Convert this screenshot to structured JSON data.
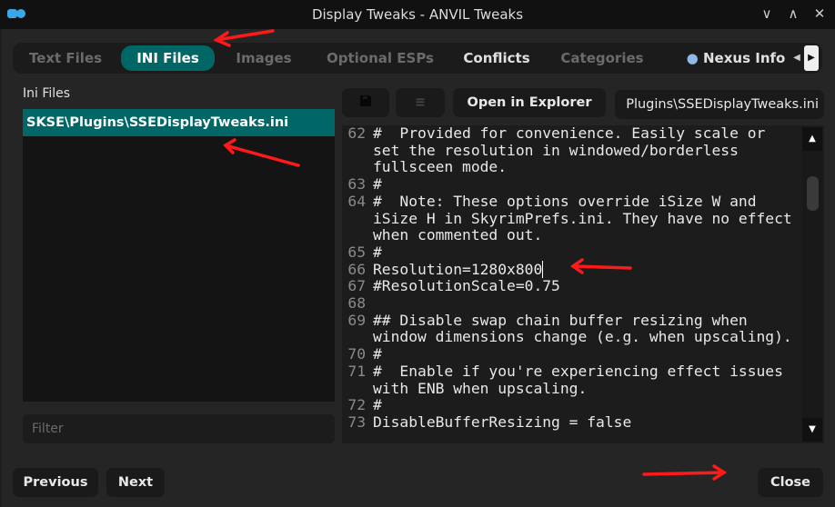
{
  "window": {
    "title": "Display Tweaks - ANVIL Tweaks",
    "minimize": "∨",
    "maximize": "∧",
    "close": "✕"
  },
  "tabs": [
    {
      "label": "Text Files"
    },
    {
      "label": "INI Files",
      "active": true
    },
    {
      "label": "Images"
    },
    {
      "label": "Optional ESPs"
    },
    {
      "label": "Conflicts"
    },
    {
      "label": "Categories"
    },
    {
      "label": "Nexus Info"
    }
  ],
  "sidebar": {
    "title": "Ini Files",
    "items": [
      {
        "label": "SKSE\\Plugins\\SSEDisplayTweaks.ini",
        "selected": true
      }
    ],
    "filter_placeholder": "Filter"
  },
  "toolbar": {
    "save_icon": "save-icon",
    "wrap_icon": "wrap-icon",
    "open_label": "Open in Explorer",
    "path_value": "Plugins\\SSEDisplayTweaks.ini"
  },
  "editor": {
    "lines": [
      {
        "n": "62",
        "t": "#  Provided for convenience. Easily scale or set the resolution in windowed/borderless fullsceen mode."
      },
      {
        "n": "63",
        "t": "#"
      },
      {
        "n": "64",
        "t": "#  Note: These options override iSize W and iSize H in SkyrimPrefs.ini. They have no effect when commented out."
      },
      {
        "n": "65",
        "t": "#"
      },
      {
        "n": "66",
        "t": "Resolution=1280x800"
      },
      {
        "n": "67",
        "t": "#ResolutionScale=0.75"
      },
      {
        "n": "68",
        "t": ""
      },
      {
        "n": "69",
        "t": "## Disable swap chain buffer resizing when window dimensions change (e.g. when upscaling)."
      },
      {
        "n": "70",
        "t": "#"
      },
      {
        "n": "71",
        "t": "#  Enable if you're experiencing effect issues with ENB when upscaling."
      },
      {
        "n": "72",
        "t": "#"
      },
      {
        "n": "73",
        "t": "DisableBufferResizing = false"
      }
    ]
  },
  "footer": {
    "previous": "Previous",
    "next": "Next",
    "close": "Close"
  },
  "colors": {
    "accent": "#006666",
    "annotation": "#ff1a1a"
  }
}
